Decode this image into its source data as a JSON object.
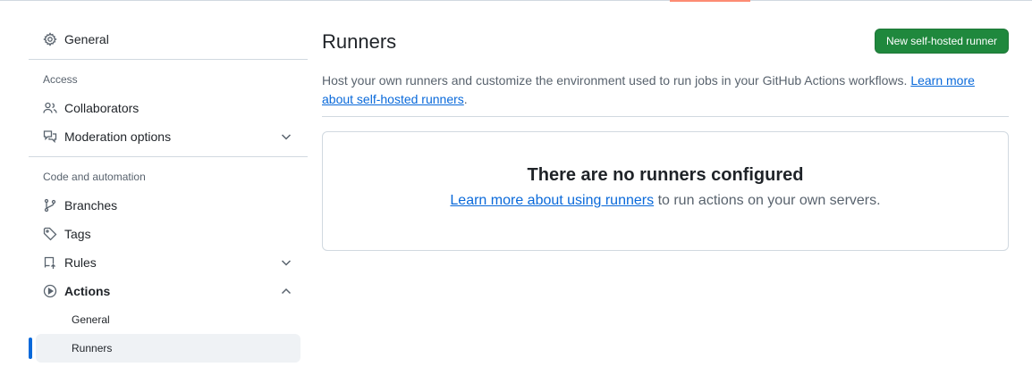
{
  "sidebar": {
    "general": {
      "label": "General",
      "icon": "gear-icon"
    },
    "access_label": "Access",
    "collaborators": {
      "label": "Collaborators",
      "icon": "people-icon"
    },
    "moderation": {
      "label": "Moderation options",
      "icon": "comment-discussion-icon"
    },
    "code_automation_label": "Code and automation",
    "branches": {
      "label": "Branches",
      "icon": "git-branch-icon"
    },
    "tags": {
      "label": "Tags",
      "icon": "tag-icon"
    },
    "rules": {
      "label": "Rules",
      "icon": "repo-push-icon"
    },
    "actions": {
      "label": "Actions",
      "icon": "play-icon",
      "sub_items": [
        "General",
        "Runners"
      ],
      "selected": "Runners"
    }
  },
  "main": {
    "title": "Runners",
    "new_button": "New self-hosted runner",
    "description": "Host your own runners and customize the environment used to run jobs in your GitHub Actions workflows.",
    "description_link": "Learn more about self-hosted runners",
    "description_end": ".",
    "blankslate": {
      "heading": "There are no runners configured",
      "link": "Learn more about using runners",
      "text": "to run actions on your own servers."
    }
  },
  "colors": {
    "accent": "#0969da",
    "primary_button": "#1f883d",
    "tab_underline": "#fd8c73"
  }
}
